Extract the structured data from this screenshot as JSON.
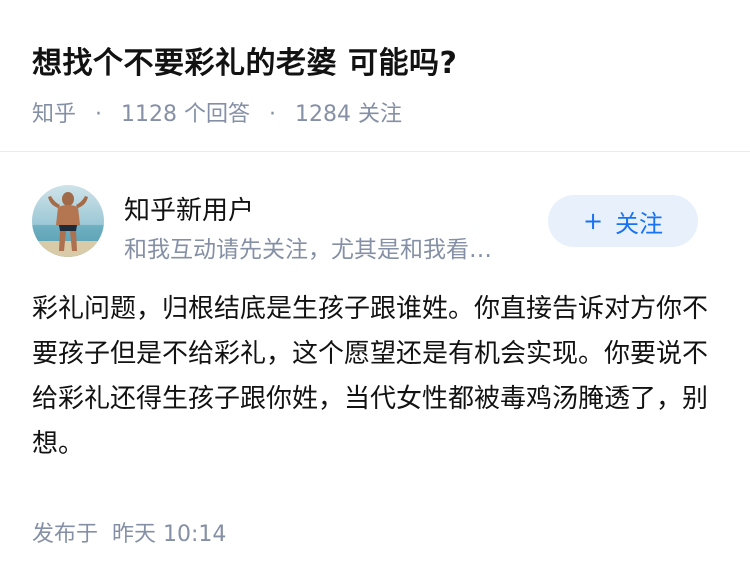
{
  "question": {
    "title": "想找个不要彩礼的老婆 可能吗?",
    "source": "知乎",
    "separator": "·",
    "answer_count": "1128 个回答",
    "follower_count": "1284 关注"
  },
  "author": {
    "name": "知乎新用户",
    "headline": "和我互动请先关注，尤其是和我看…",
    "follow_label": "关注",
    "follow_icon": "+"
  },
  "answer": {
    "content": "彩礼问题，归根结底是生孩子跟谁姓。你直接告诉对方你不要孩子但是不给彩礼，这个愿望还是有机会实现。你要说不给彩礼还得生孩子跟你姓，当代女性都被毒鸡汤腌透了，别想。",
    "published_label": "发布于",
    "published_time": "昨天 10:14"
  },
  "colors": {
    "accent": "#1772f6",
    "muted": "#8590a6",
    "follow_bg": "#e8f0fb",
    "text": "#121212"
  },
  "icons": {
    "avatar": "avatar-photo",
    "follow": "plus-icon"
  }
}
